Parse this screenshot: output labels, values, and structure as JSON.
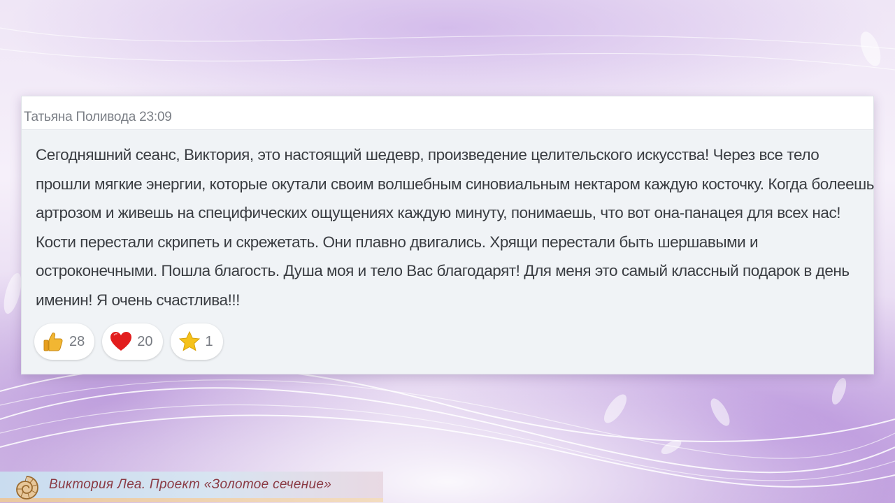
{
  "post": {
    "author": "Татьяна Поливода",
    "time": "23:09",
    "text": "Сегодняшний сеанс, Виктория, это настоящий шедевр, произведение целительского искусства! Через все тело прошли мягкие энергии, которые окутали своим волшебным синовиальным нектаром каждую косточку. Когда болеешь артрозом и живешь на специфических ощущениях каждую минуту, понимаешь, что вот она-панацея для всех нас! Кости перестали скрипеть и скрежетать. Они плавно двигались. Хрящи перестали быть шершавыми и остроконечными. Пошла благость. Душа моя и тело Вас благодарят! Для меня это самый классный подарок в день именин! Я очень счастлива!!!",
    "reactions": [
      {
        "icon": "thumbs-up-icon",
        "count": "28"
      },
      {
        "icon": "heart-icon",
        "count": "20"
      },
      {
        "icon": "star-icon",
        "count": "1"
      }
    ]
  },
  "footer": {
    "caption": "Виктория Леа. Проект «Золотое сечение»"
  },
  "colors": {
    "card_background": "#f0f3f6",
    "caption_color": "#8a3a44",
    "heart": "#e21d1d",
    "star": "#f5c21b",
    "thumb": "#f2b632"
  }
}
